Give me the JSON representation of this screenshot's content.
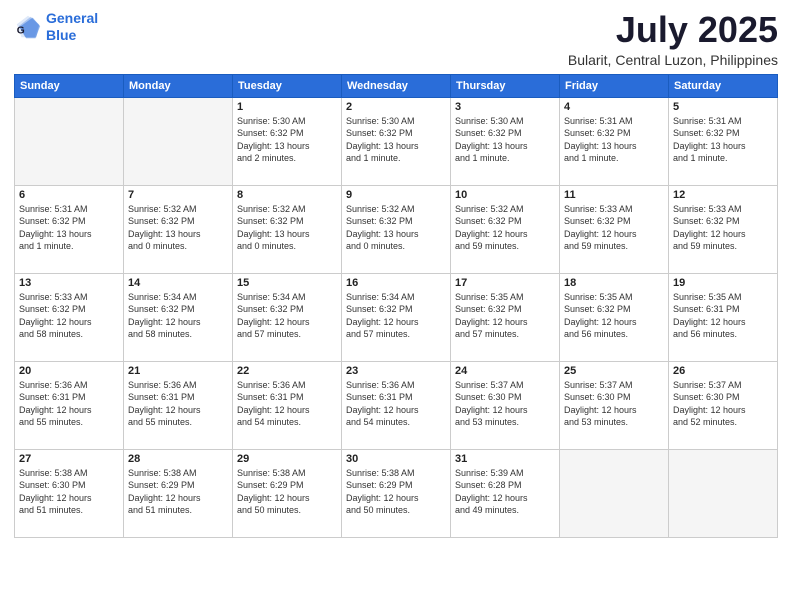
{
  "header": {
    "logo_line1": "General",
    "logo_line2": "Blue",
    "title": "July 2025",
    "subtitle": "Bularit, Central Luzon, Philippines"
  },
  "calendar": {
    "days_of_week": [
      "Sunday",
      "Monday",
      "Tuesday",
      "Wednesday",
      "Thursday",
      "Friday",
      "Saturday"
    ],
    "weeks": [
      [
        {
          "day": "",
          "info": "",
          "empty": true
        },
        {
          "day": "",
          "info": "",
          "empty": true
        },
        {
          "day": "1",
          "info": "Sunrise: 5:30 AM\nSunset: 6:32 PM\nDaylight: 13 hours\nand 2 minutes.",
          "empty": false
        },
        {
          "day": "2",
          "info": "Sunrise: 5:30 AM\nSunset: 6:32 PM\nDaylight: 13 hours\nand 1 minute.",
          "empty": false
        },
        {
          "day": "3",
          "info": "Sunrise: 5:30 AM\nSunset: 6:32 PM\nDaylight: 13 hours\nand 1 minute.",
          "empty": false
        },
        {
          "day": "4",
          "info": "Sunrise: 5:31 AM\nSunset: 6:32 PM\nDaylight: 13 hours\nand 1 minute.",
          "empty": false
        },
        {
          "day": "5",
          "info": "Sunrise: 5:31 AM\nSunset: 6:32 PM\nDaylight: 13 hours\nand 1 minute.",
          "empty": false
        }
      ],
      [
        {
          "day": "6",
          "info": "Sunrise: 5:31 AM\nSunset: 6:32 PM\nDaylight: 13 hours\nand 1 minute.",
          "empty": false
        },
        {
          "day": "7",
          "info": "Sunrise: 5:32 AM\nSunset: 6:32 PM\nDaylight: 13 hours\nand 0 minutes.",
          "empty": false
        },
        {
          "day": "8",
          "info": "Sunrise: 5:32 AM\nSunset: 6:32 PM\nDaylight: 13 hours\nand 0 minutes.",
          "empty": false
        },
        {
          "day": "9",
          "info": "Sunrise: 5:32 AM\nSunset: 6:32 PM\nDaylight: 13 hours\nand 0 minutes.",
          "empty": false
        },
        {
          "day": "10",
          "info": "Sunrise: 5:32 AM\nSunset: 6:32 PM\nDaylight: 12 hours\nand 59 minutes.",
          "empty": false
        },
        {
          "day": "11",
          "info": "Sunrise: 5:33 AM\nSunset: 6:32 PM\nDaylight: 12 hours\nand 59 minutes.",
          "empty": false
        },
        {
          "day": "12",
          "info": "Sunrise: 5:33 AM\nSunset: 6:32 PM\nDaylight: 12 hours\nand 59 minutes.",
          "empty": false
        }
      ],
      [
        {
          "day": "13",
          "info": "Sunrise: 5:33 AM\nSunset: 6:32 PM\nDaylight: 12 hours\nand 58 minutes.",
          "empty": false
        },
        {
          "day": "14",
          "info": "Sunrise: 5:34 AM\nSunset: 6:32 PM\nDaylight: 12 hours\nand 58 minutes.",
          "empty": false
        },
        {
          "day": "15",
          "info": "Sunrise: 5:34 AM\nSunset: 6:32 PM\nDaylight: 12 hours\nand 57 minutes.",
          "empty": false
        },
        {
          "day": "16",
          "info": "Sunrise: 5:34 AM\nSunset: 6:32 PM\nDaylight: 12 hours\nand 57 minutes.",
          "empty": false
        },
        {
          "day": "17",
          "info": "Sunrise: 5:35 AM\nSunset: 6:32 PM\nDaylight: 12 hours\nand 57 minutes.",
          "empty": false
        },
        {
          "day": "18",
          "info": "Sunrise: 5:35 AM\nSunset: 6:32 PM\nDaylight: 12 hours\nand 56 minutes.",
          "empty": false
        },
        {
          "day": "19",
          "info": "Sunrise: 5:35 AM\nSunset: 6:31 PM\nDaylight: 12 hours\nand 56 minutes.",
          "empty": false
        }
      ],
      [
        {
          "day": "20",
          "info": "Sunrise: 5:36 AM\nSunset: 6:31 PM\nDaylight: 12 hours\nand 55 minutes.",
          "empty": false
        },
        {
          "day": "21",
          "info": "Sunrise: 5:36 AM\nSunset: 6:31 PM\nDaylight: 12 hours\nand 55 minutes.",
          "empty": false
        },
        {
          "day": "22",
          "info": "Sunrise: 5:36 AM\nSunset: 6:31 PM\nDaylight: 12 hours\nand 54 minutes.",
          "empty": false
        },
        {
          "day": "23",
          "info": "Sunrise: 5:36 AM\nSunset: 6:31 PM\nDaylight: 12 hours\nand 54 minutes.",
          "empty": false
        },
        {
          "day": "24",
          "info": "Sunrise: 5:37 AM\nSunset: 6:30 PM\nDaylight: 12 hours\nand 53 minutes.",
          "empty": false
        },
        {
          "day": "25",
          "info": "Sunrise: 5:37 AM\nSunset: 6:30 PM\nDaylight: 12 hours\nand 53 minutes.",
          "empty": false
        },
        {
          "day": "26",
          "info": "Sunrise: 5:37 AM\nSunset: 6:30 PM\nDaylight: 12 hours\nand 52 minutes.",
          "empty": false
        }
      ],
      [
        {
          "day": "27",
          "info": "Sunrise: 5:38 AM\nSunset: 6:30 PM\nDaylight: 12 hours\nand 51 minutes.",
          "empty": false
        },
        {
          "day": "28",
          "info": "Sunrise: 5:38 AM\nSunset: 6:29 PM\nDaylight: 12 hours\nand 51 minutes.",
          "empty": false
        },
        {
          "day": "29",
          "info": "Sunrise: 5:38 AM\nSunset: 6:29 PM\nDaylight: 12 hours\nand 50 minutes.",
          "empty": false
        },
        {
          "day": "30",
          "info": "Sunrise: 5:38 AM\nSunset: 6:29 PM\nDaylight: 12 hours\nand 50 minutes.",
          "empty": false
        },
        {
          "day": "31",
          "info": "Sunrise: 5:39 AM\nSunset: 6:28 PM\nDaylight: 12 hours\nand 49 minutes.",
          "empty": false
        },
        {
          "day": "",
          "info": "",
          "empty": true
        },
        {
          "day": "",
          "info": "",
          "empty": true
        }
      ]
    ]
  }
}
